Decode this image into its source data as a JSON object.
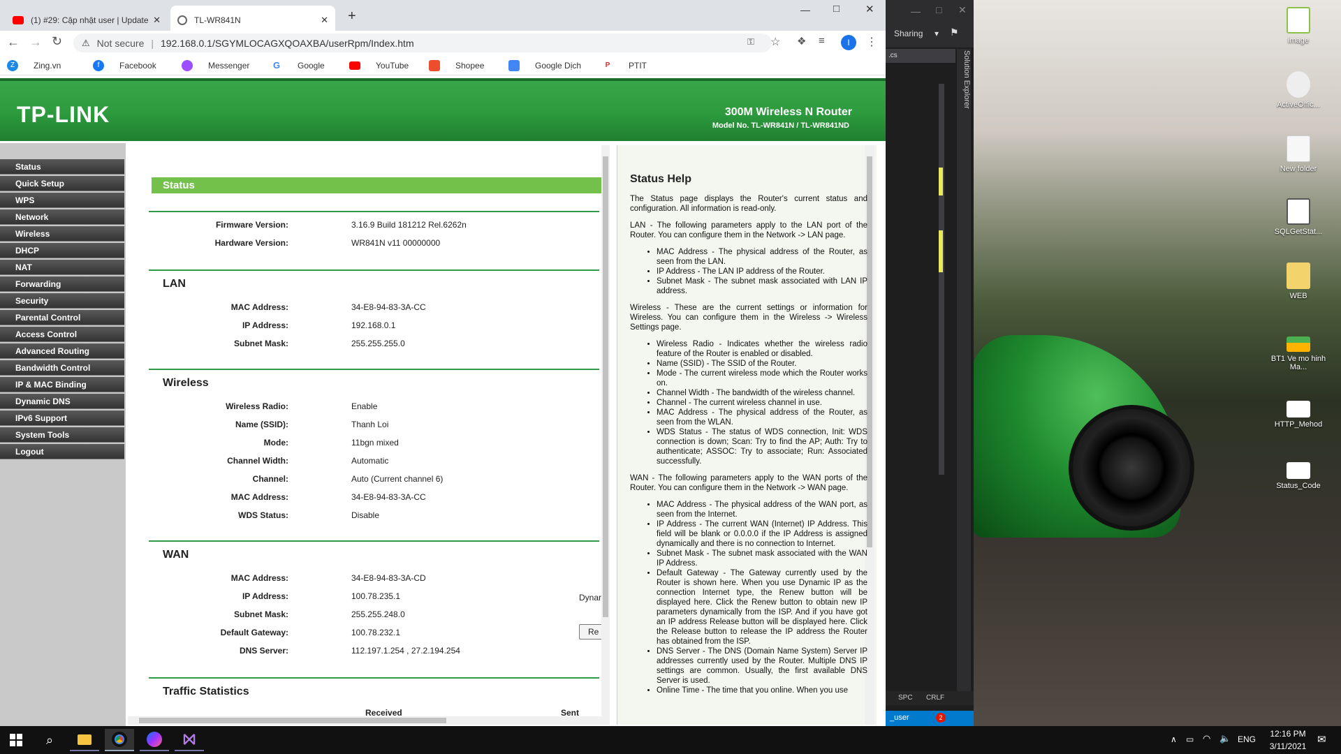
{
  "browser": {
    "tabs": [
      {
        "label": "(1) #29: Cập nhật user | Update e",
        "icon": "youtube-icon"
      },
      {
        "label": "TL-WR841N",
        "icon": "globe-icon"
      }
    ],
    "security_label": "Not secure",
    "url": "192.168.0.1/SGYMLOCAGXQOAXBA/userRpm/Index.htm",
    "profile_initial": "I",
    "bookmarks": [
      "Zing.vn",
      "Facebook",
      "Messenger",
      "Google",
      "YouTube",
      "Shopee",
      "Google Dịch",
      "PTIT"
    ]
  },
  "banner": {
    "logo": "TP-LINK",
    "product": "300M Wireless N Router",
    "model": "Model No. TL-WR841N / TL-WR841ND"
  },
  "menu": [
    "Status",
    "Quick Setup",
    "WPS",
    "Network",
    "Wireless",
    "DHCP",
    "NAT",
    "Forwarding",
    "Security",
    "Parental Control",
    "Access Control",
    "Advanced Routing",
    "Bandwidth Control",
    "IP & MAC Binding",
    "Dynamic DNS",
    "IPv6 Support",
    "System Tools",
    "Logout"
  ],
  "status": {
    "header": "Status",
    "firmware_label": "Firmware Version:",
    "firmware": "3.16.9 Build 181212 Rel.6262n",
    "hardware_label": "Hardware Version:",
    "hardware": "WR841N v11 00000000",
    "lan": {
      "title": "LAN",
      "rows": [
        {
          "label": "MAC Address:",
          "value": "34-E8-94-83-3A-CC"
        },
        {
          "label": "IP Address:",
          "value": "192.168.0.1"
        },
        {
          "label": "Subnet Mask:",
          "value": "255.255.255.0"
        }
      ]
    },
    "wireless": {
      "title": "Wireless",
      "rows": [
        {
          "label": "Wireless Radio:",
          "value": "Enable"
        },
        {
          "label": "Name (SSID):",
          "value": "Thanh Loi"
        },
        {
          "label": "Mode:",
          "value": "11bgn mixed"
        },
        {
          "label": "Channel Width:",
          "value": "Automatic"
        },
        {
          "label": "Channel:",
          "value": "Auto (Current channel 6)"
        },
        {
          "label": "MAC Address:",
          "value": "34-E8-94-83-3A-CC"
        },
        {
          "label": "WDS Status:",
          "value": "Disable"
        }
      ]
    },
    "wan": {
      "title": "WAN",
      "rows": [
        {
          "label": "MAC Address:",
          "value": "34-E8-94-83-3A-CD"
        },
        {
          "label": "IP Address:",
          "value": "100.78.235.1"
        },
        {
          "label": "Subnet Mask:",
          "value": "255.255.248.0"
        },
        {
          "label": "Default Gateway:",
          "value": "100.78.232.1"
        },
        {
          "label": "DNS Server:",
          "value": "112.197.1.254 , 27.2.194.254"
        }
      ],
      "dyn_text": "Dynar",
      "renew_label": "Re"
    },
    "traffic": {
      "title": "Traffic Statistics",
      "received": "Received",
      "sent": "Sent"
    }
  },
  "help": {
    "title": "Status Help",
    "intro": "The Status page displays the Router's current status and configuration. All information is read-only.",
    "lan_intro": "LAN - The following parameters apply to the LAN port of the Router. You can configure them in the Network -> LAN page.",
    "lan_items": [
      "MAC Address - The physical address of the Router, as seen from the LAN.",
      "IP Address - The LAN IP address of the Router.",
      "Subnet Mask - The subnet mask associated with LAN IP address."
    ],
    "wireless_intro": "Wireless - These are the current settings or information for Wireless. You can configure them in the Wireless -> Wireless Settings page.",
    "wireless_items": [
      "Wireless Radio - Indicates whether the wireless radio feature of the Router is enabled or disabled.",
      "Name (SSID) - The SSID of the Router.",
      "Mode - The current wireless mode which the Router works on.",
      "Channel Width - The bandwidth of the wireless channel.",
      "Channel - The current wireless channel in use.",
      "MAC Address - The physical address of the Router, as seen from the WLAN.",
      "WDS Status - The status of WDS connection, Init: WDS connection is down; Scan: Try to find the AP; Auth: Try to authenticate; ASSOC: Try to associate; Run: Associated successfully."
    ],
    "wan_intro": "WAN - The following parameters apply to the WAN ports of the Router. You can configure them in the Network -> WAN page.",
    "wan_items": [
      "MAC Address - The physical address of the WAN port, as seen from the Internet.",
      "IP Address - The current WAN (Internet) IP Address. This field will be blank or 0.0.0.0 if the IP Address is assigned dynamically and there is no connection to Internet.",
      "Subnet Mask - The subnet mask associated with the WAN IP Address.",
      "Default Gateway - The Gateway currently used by the Router is shown here. When you use Dynamic IP as the connection Internet type, the Renew button will be displayed here. Click the Renew button to obtain new IP parameters dynamically from the ISP. And if you have got an IP address Release button will be displayed here. Click the Release button to release the IP address the Router has obtained from the ISP.",
      "DNS Server - The DNS (Domain Name System) Server IP addresses currently used by the Router. Multiple DNS IP settings are common. Usually, the first available DNS Server is used.",
      "Online Time - The time that you online. When you use"
    ]
  },
  "vs": {
    "sharing": "Sharing",
    "tab_text": ".cs",
    "solution_explorer": "Solution Explorer",
    "status_spc": "SPC",
    "status_crlf": "CRLF",
    "status_user": "_user",
    "notif_count": "2"
  },
  "desktop_icons": [
    "image",
    "ActiveOffic...",
    "New folder",
    "SQLGetStat...",
    "WEB",
    "BT1 Ve mo hinh Ma...",
    "HTTP_Mehod",
    "Status_Code"
  ],
  "taskbar": {
    "lang": "ENG",
    "time": "12:16 PM",
    "date": "3/11/2021"
  }
}
